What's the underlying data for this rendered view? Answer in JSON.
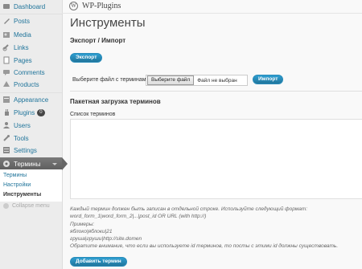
{
  "sidebar": {
    "items": [
      {
        "label": "Dashboard",
        "icon": "dashboard-icon"
      },
      {
        "label": "Posts",
        "icon": "posts-icon"
      },
      {
        "label": "Media",
        "icon": "media-icon"
      },
      {
        "label": "Links",
        "icon": "links-icon"
      },
      {
        "label": "Pages",
        "icon": "pages-icon"
      },
      {
        "label": "Comments",
        "icon": "comments-icon"
      },
      {
        "label": "Products",
        "icon": "products-icon"
      },
      {
        "label": "Appearance",
        "icon": "appearance-icon"
      },
      {
        "label": "Plugins",
        "icon": "plugins-icon",
        "badge": "0"
      },
      {
        "label": "Users",
        "icon": "users-icon"
      },
      {
        "label": "Tools",
        "icon": "tools-icon"
      },
      {
        "label": "Settings",
        "icon": "settings-icon"
      },
      {
        "label": "Термины",
        "icon": "terms-icon"
      }
    ],
    "submenu": [
      "Термины",
      "Настройки",
      "Инструменты"
    ],
    "collapse_label": "Collapse menu"
  },
  "topbar": {
    "site_title": "WP-Plugins"
  },
  "page": {
    "title": "Инструменты",
    "export_heading": "Экспорт / Импорт",
    "export_button": "Экспорт",
    "file_label": "Выберите файл с терминами",
    "file_button": "Выберите файл",
    "file_none": "Файл не выбран",
    "import_button": "Импорт",
    "bulk_heading": "Пакетная загрузка терминов",
    "list_label": "Список терминов",
    "help_lines": [
      "Каждый термин должен быть записан в отдельной строке. Используйте следующий формат:",
      "word_form_1|word_form_2|...|post_id OR URL (with http://)",
      "Примеры:",
      "яблоко|яблоки|21",
      "груша|груши|http://site.domen",
      "Обратите внимание, что если вы используете id терминов, то посты с этими id должны существовать."
    ],
    "add_button": "Добавить термин"
  },
  "colors": {
    "accent": "#21759b",
    "button": "#2e9fd2"
  }
}
